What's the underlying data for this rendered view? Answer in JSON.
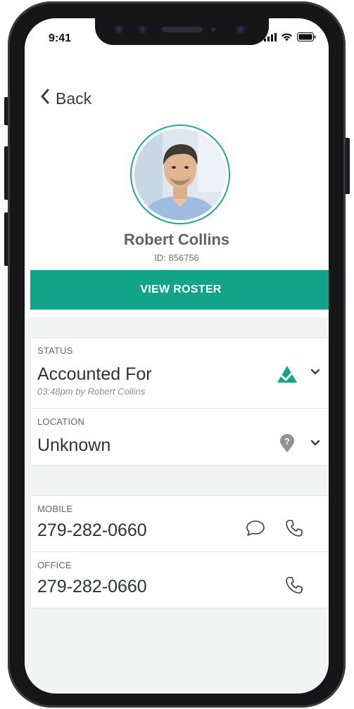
{
  "status_bar": {
    "time": "9:41"
  },
  "nav": {
    "back_label": "Back"
  },
  "profile": {
    "name": "Robert Collins",
    "id_text": "ID: 856756"
  },
  "actions": {
    "view_roster_label": "VIEW ROSTER"
  },
  "status_card": {
    "status_label": "STATUS",
    "status_value": "Accounted For",
    "status_sub": "03:48pm by Robert Collins",
    "location_label": "LOCATION",
    "location_value": "Unknown"
  },
  "contact_card": {
    "mobile_label": "MOBILE",
    "mobile_value": "279-282-0660",
    "office_label": "OFFICE",
    "office_value": "279-282-0660"
  },
  "colors": {
    "accent": "#12a389",
    "avatar_ring": "#1fa891",
    "screen_bg": "#f2f3f3"
  }
}
